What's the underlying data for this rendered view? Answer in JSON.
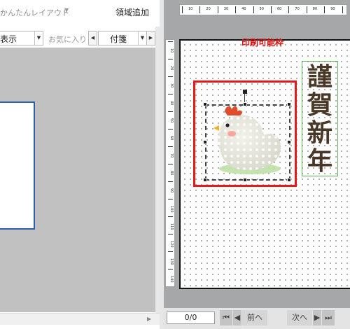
{
  "left_toolbar": {
    "easy_layout": "かんたんレイアウト",
    "area_add": "領域追加",
    "display_value": "表示",
    "favorites_label": "お気に入り",
    "fusen_value": "付箋"
  },
  "icons": {
    "dropdown": "chevron-down-icon",
    "prev": "triangle-left-icon",
    "next": "triangle-right-icon"
  },
  "rulers": {
    "top": [
      "10",
      "20",
      "30",
      "40",
      "50",
      "60",
      "70",
      "80",
      "90"
    ],
    "left": [
      "10",
      "20",
      "30",
      "40",
      "50",
      "60",
      "70",
      "80",
      "90",
      "100",
      "110",
      "120",
      "130",
      "140"
    ]
  },
  "canvas": {
    "printable_label": "印刷可能枠",
    "greeting_text": "謹賀新年"
  },
  "pager": {
    "page_indicator": "0/0",
    "prev_label": "前へ",
    "next_label": "次へ"
  },
  "colors": {
    "selection": "#e31b1b",
    "greeting_frame": "#5ab25a",
    "thumbnail_border": "#2a5ea8"
  }
}
